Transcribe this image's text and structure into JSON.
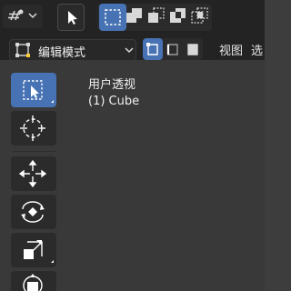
{
  "header": {
    "mode_label": "编辑模式",
    "view_menu": "视图",
    "next_menu": "选"
  },
  "viewport": {
    "title": "用户透视",
    "object": "(1) Cube"
  },
  "colors": {
    "accent": "#4772b3",
    "header_bg": "#232323",
    "viewport_bg": "#393939"
  },
  "icons": {
    "transform_pivot": "hash-pivot-icon",
    "select_tool": "cursor-arrow-icon",
    "select_modes": [
      "select-new-icon",
      "select-extend-icon",
      "select-subtract-icon",
      "select-difference-icon",
      "select-intersect-icon"
    ],
    "edit_mode": "edit-mode-icon",
    "tools": [
      "select-box-icon",
      "cursor-icon",
      "move-icon",
      "rotate-icon",
      "scale-icon",
      "transform-icon"
    ]
  }
}
